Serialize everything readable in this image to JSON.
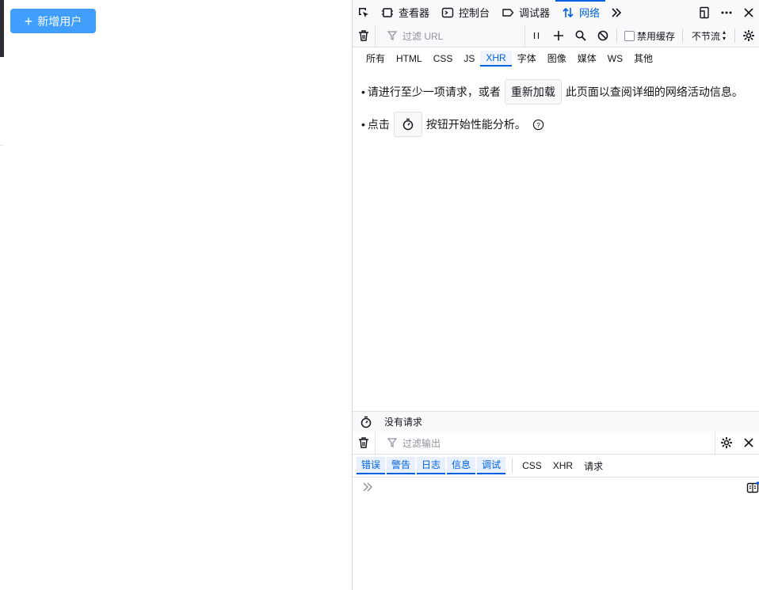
{
  "page": {
    "add_user_button": "新增用户"
  },
  "devtools": {
    "tabs": [
      {
        "label": "查看器",
        "icon": "inspector-icon"
      },
      {
        "label": "控制台",
        "icon": "console-icon"
      },
      {
        "label": "调试器",
        "icon": "debugger-icon"
      },
      {
        "label": "网络",
        "icon": "network-icon",
        "active": true
      }
    ],
    "network": {
      "filter_placeholder": "过滤 URL",
      "disable_cache_label": "禁用缓存",
      "throttle_value": "不节流",
      "type_filters": [
        "所有",
        "HTML",
        "CSS",
        "JS",
        "XHR",
        "字体",
        "图像",
        "媒体",
        "WS",
        "其他"
      ],
      "active_type": "XHR",
      "empty": {
        "line1_prefix": "请进行至少一项请求，或者",
        "reload_button": "重新加载",
        "line1_suffix": "此页面以查阅详细的网络活动信息。",
        "line2_prefix": "点击",
        "line2_suffix": "按钮开始性能分析。"
      },
      "status_text": "没有请求"
    },
    "console": {
      "filter_placeholder": "过滤输出",
      "levels": [
        "错误",
        "警告",
        "日志",
        "信息",
        "调试"
      ],
      "extra_filters": [
        "CSS",
        "XHR",
        "请求"
      ]
    }
  },
  "colors": {
    "accent": "#0061e0",
    "primary_button": "#409eff"
  }
}
